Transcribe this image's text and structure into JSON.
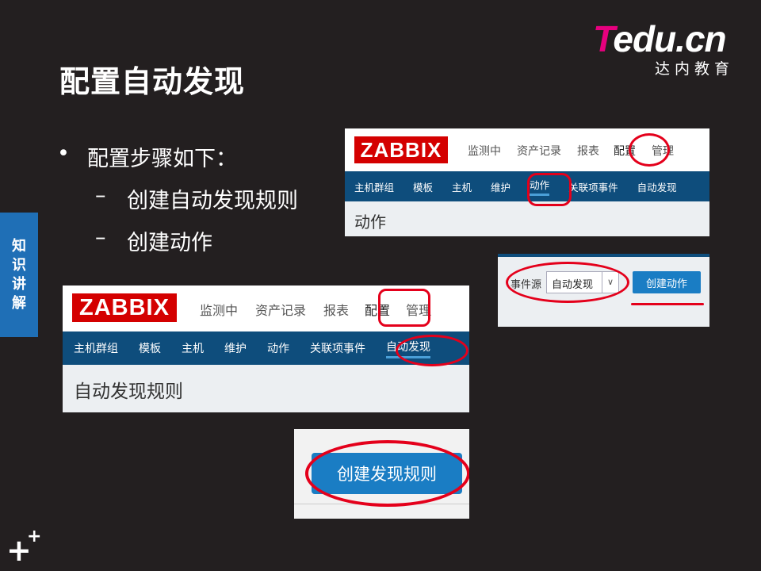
{
  "slide": {
    "title": "配置自动发现",
    "logo_brand_t": "T",
    "logo_brand_rest": "edu.cn",
    "logo_sub": "达内教育",
    "side_tab": [
      "知",
      "识",
      "讲",
      "解"
    ],
    "bullet_main": "配置步骤如下：",
    "bullet_sub": [
      "创建自动发现规则",
      "创建动作"
    ],
    "dash": "–"
  },
  "shot1": {
    "logo": "ZABBIX",
    "topnav": [
      "监测中",
      "资产记录",
      "报表",
      "配置",
      "管理"
    ],
    "subnav": [
      "主机群组",
      "模板",
      "主机",
      "维护",
      "动作",
      "关联项事件",
      "自动发现"
    ],
    "page_title": "动作"
  },
  "shot2": {
    "label": "事件源",
    "select_value": "自动发现",
    "button": "创建动作"
  },
  "shot3": {
    "logo": "ZABBIX",
    "topnav": [
      "监测中",
      "资产记录",
      "报表",
      "配置",
      "管理"
    ],
    "subnav": [
      "主机群组",
      "模板",
      "主机",
      "维护",
      "动作",
      "关联项事件",
      "自动发现"
    ],
    "page_title": "自动发现规则"
  },
  "shot4": {
    "button": "创建发现规则"
  },
  "colors": {
    "accent_blue": "#1f6fb6",
    "zabbix_red": "#d40000",
    "nav_blue": "#0e4d7c",
    "mark_red": "#e4001b",
    "brand_pink": "#e6007e"
  }
}
